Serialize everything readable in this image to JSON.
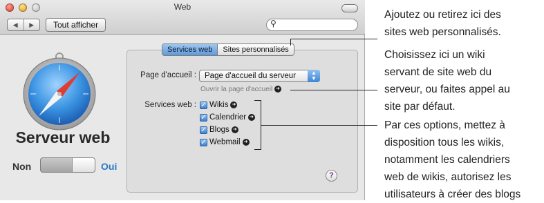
{
  "window": {
    "title": "Web",
    "search_icon": "search-icon"
  },
  "toolbar": {
    "back": "◀",
    "forward": "▶",
    "show_all": "Tout afficher"
  },
  "left": {
    "service_title": "Serveur web",
    "toggle_off": "Non",
    "toggle_on": "Oui",
    "toggle_state": "on"
  },
  "tabs": [
    {
      "label": "Services web",
      "selected": true
    },
    {
      "label": "Sites personnalisés",
      "selected": false
    }
  ],
  "home": {
    "label": "Page d'accueil :",
    "value": "Page d'accueil du serveur",
    "open_link": "Ouvrir la page d'accueil"
  },
  "services": {
    "label": "Services web :",
    "items": [
      {
        "label": "Wikis",
        "checked": true
      },
      {
        "label": "Calendrier",
        "checked": true
      },
      {
        "label": "Blogs",
        "checked": true
      },
      {
        "label": "Webmail",
        "checked": true
      }
    ]
  },
  "help": "?",
  "notes": {
    "n1": [
      "Ajoutez ou retirez ici des",
      "sites web personnalisés."
    ],
    "n2": [
      "Choisissez ici un wiki",
      "servant de site web du",
      "serveur, ou faites appel au",
      "site par défaut."
    ],
    "n3": [
      "Par ces options, mettez à",
      "disposition tous les wikis,",
      "notamment les calendriers",
      "web de wikis, autorisez les",
      "utilisateurs à créer des blogs"
    ]
  },
  "colors": {
    "accent": "#3d7fcf",
    "on_label": "#2a78c7"
  }
}
